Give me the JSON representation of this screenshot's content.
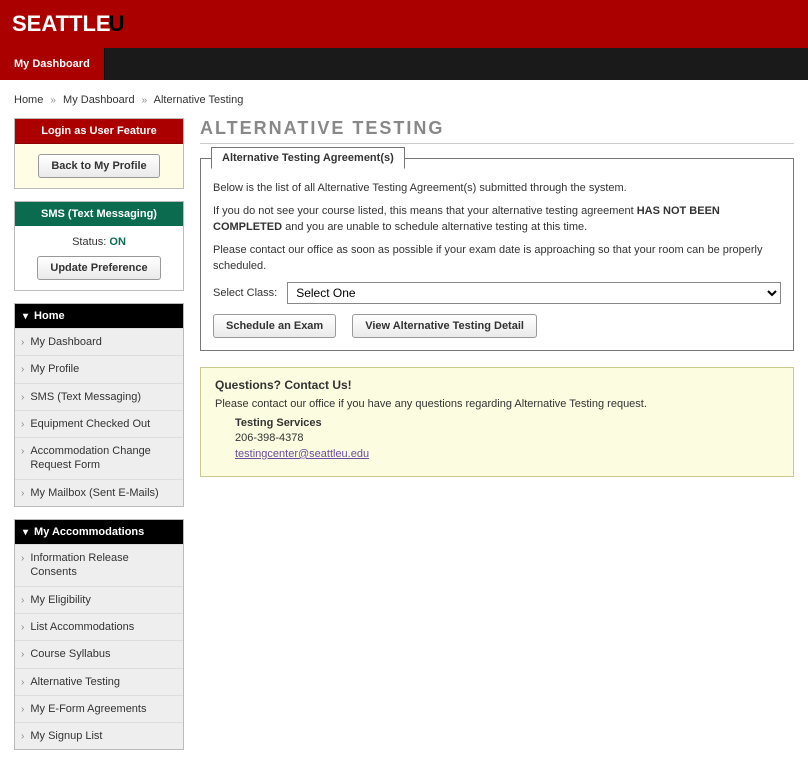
{
  "logo": {
    "text1": "SEATTLE",
    "text2": "U"
  },
  "topnav": {
    "dashboard": "My Dashboard"
  },
  "breadcrumbs": {
    "home": "Home",
    "dash": "My Dashboard",
    "current": "Alternative Testing"
  },
  "login_box": {
    "title": "Login as User Feature",
    "back_btn": "Back to My Profile"
  },
  "sms_box": {
    "title": "SMS (Text Messaging)",
    "status_label": "Status: ",
    "status_value": "ON",
    "update_btn": "Update Preference"
  },
  "nav_home": {
    "title": "Home",
    "items": [
      "My Dashboard",
      "My Profile",
      "SMS (Text Messaging)",
      "Equipment Checked Out",
      "Accommodation Change Request Form",
      "My Mailbox (Sent E-Mails)"
    ]
  },
  "nav_accom": {
    "title": "My Accommodations",
    "items": [
      "Information Release Consents",
      "My Eligibility",
      "List Accommodations",
      "Course Syllabus",
      "Alternative Testing",
      "My E-Form Agreements",
      "My Signup List"
    ]
  },
  "page": {
    "title": "ALTERNATIVE TESTING",
    "tab_label": "Alternative Testing Agreement(s)",
    "p1": "Below is the list of all Alternative Testing Agreement(s) submitted through the system.",
    "p2a": "If you do not see your course listed, this means that your alternative testing agreement ",
    "p2b": "HAS NOT BEEN COMPLETED",
    "p2c": " and you are unable to schedule alternative testing at this time.",
    "p3": "Please contact our office as soon as possible if your exam date is approaching so that your room can be properly scheduled.",
    "select_label": "Select Class:",
    "select_value": "Select One",
    "btn_schedule": "Schedule an Exam",
    "btn_view": "View Alternative Testing Detail"
  },
  "questions": {
    "title": "Questions? Contact Us!",
    "p": "Please contact our office if you have any questions regarding Alternative Testing request.",
    "dept": "Testing Services",
    "phone": "206-398-4378",
    "email": "testingcenter@seattleu.edu"
  }
}
